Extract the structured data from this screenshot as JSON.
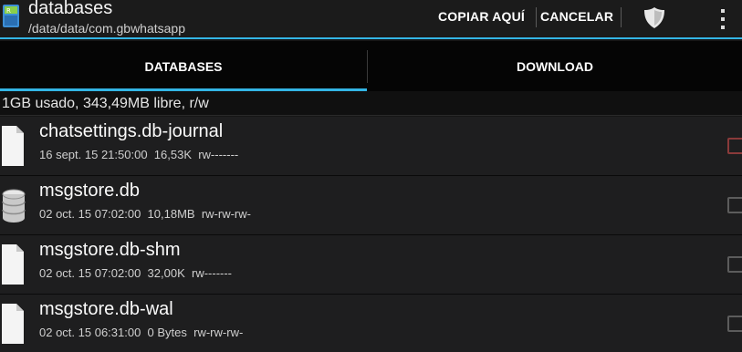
{
  "action_bar": {
    "title": "databases",
    "subtitle": "/data/data/com.gbwhatsapp",
    "app_icon": "app-icon",
    "copy_here_label": "COPIAR AQUÍ",
    "cancel_label": "CANCELAR",
    "shield_icon": "shield-icon",
    "overflow_icon": "overflow-menu-icon"
  },
  "tabs": [
    {
      "label": "DATABASES",
      "selected": true
    },
    {
      "label": "DOWNLOAD",
      "selected": false
    }
  ],
  "storage_info": "1GB usado, 343,49MB libre, r/w",
  "files": [
    {
      "name": "chatsettings.db-journal",
      "date": "16 sept. 15 21:50:00",
      "size": "16,53K",
      "perms": "rw-------",
      "icon": "file-icon"
    },
    {
      "name": "msgstore.db",
      "date": "02 oct. 15 07:02:00",
      "size": "10,18MB",
      "perms": "rw-rw-rw-",
      "icon": "database-icon"
    },
    {
      "name": "msgstore.db-shm",
      "date": "02 oct. 15 07:02:00",
      "size": "32,00K",
      "perms": "rw-------",
      "icon": "file-icon"
    },
    {
      "name": "msgstore.db-wal",
      "date": "02 oct. 15 06:31:00",
      "size": "0 Bytes",
      "perms": "rw-rw-rw-",
      "icon": "file-icon"
    }
  ],
  "colors": {
    "accent": "#33b5e5",
    "background": "#1e1e1f",
    "action_bar": "#1b1b1b",
    "tabs": "#050505"
  }
}
